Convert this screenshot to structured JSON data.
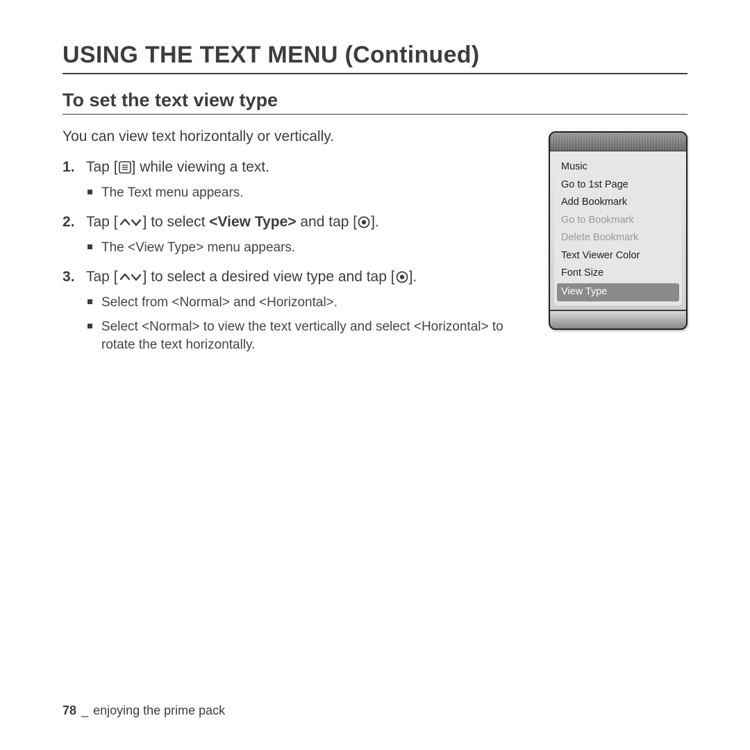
{
  "page_title": "USING THE TEXT MENU (Continued)",
  "section_title": "To set the text view type",
  "intro": "You can view text horizontally or vertically.",
  "steps": {
    "s1": {
      "pre": "Tap [",
      "post": "] while viewing a text.",
      "sub1": "The Text menu appears."
    },
    "s2": {
      "pre": "Tap [",
      "mid": "] to select ",
      "bold": "<View Type>",
      "mid2": " and tap [",
      "post": "].",
      "sub1": "The <View Type> menu appears."
    },
    "s3": {
      "pre": "Tap [",
      "mid": "] to select a desired view type and tap [",
      "post": "].",
      "sub1": "Select from <Normal> and <Horizontal>.",
      "sub2": "Select <Normal> to view the text vertically and select <Horizontal> to rotate the text horizontally."
    }
  },
  "device_menu": {
    "items": [
      {
        "label": "Music",
        "state": "normal"
      },
      {
        "label": "Go to 1st Page",
        "state": "normal"
      },
      {
        "label": "Add Bookmark",
        "state": "normal"
      },
      {
        "label": "Go to Bookmark",
        "state": "disabled"
      },
      {
        "label": "Delete Bookmark",
        "state": "disabled"
      },
      {
        "label": "Text Viewer Color",
        "state": "normal"
      },
      {
        "label": "Font Size",
        "state": "normal"
      },
      {
        "label": "View Type",
        "state": "selected"
      }
    ]
  },
  "footer": {
    "page_number": "78",
    "separator": "_",
    "chapter": "enjoying the prime pack"
  }
}
